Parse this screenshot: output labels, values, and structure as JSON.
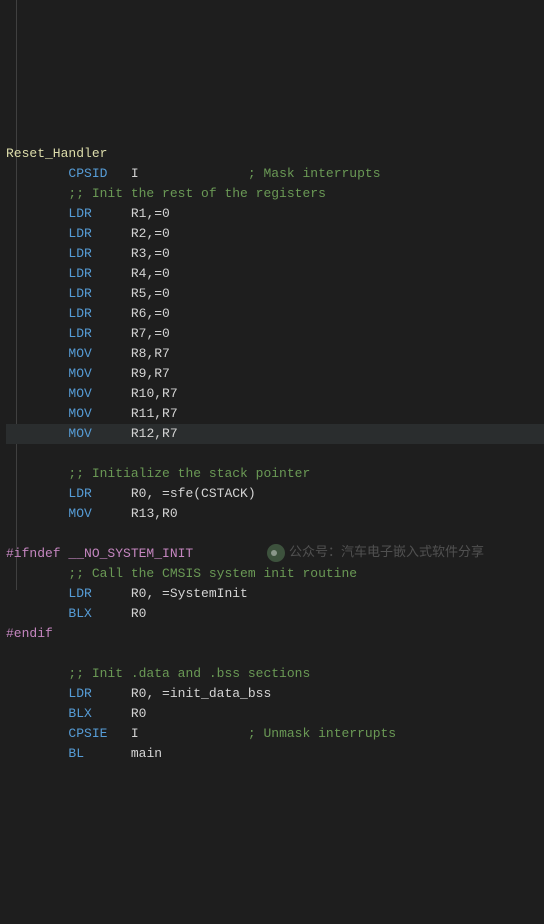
{
  "label": "Reset_Handler",
  "lines": [
    {
      "indent": 8,
      "mnemonic": "CPSID",
      "args": "I",
      "args_pad": 15,
      "comment": "; Mask interrupts"
    },
    {
      "indent": 8,
      "comment_only": ";; Init the rest of the registers"
    },
    {
      "indent": 8,
      "mnemonic": "LDR",
      "args": "R1,=0"
    },
    {
      "indent": 8,
      "mnemonic": "LDR",
      "args": "R2,=0"
    },
    {
      "indent": 8,
      "mnemonic": "LDR",
      "args": "R3,=0"
    },
    {
      "indent": 8,
      "mnemonic": "LDR",
      "args": "R4,=0"
    },
    {
      "indent": 8,
      "mnemonic": "LDR",
      "args": "R5,=0"
    },
    {
      "indent": 8,
      "mnemonic": "LDR",
      "args": "R6,=0"
    },
    {
      "indent": 8,
      "mnemonic": "LDR",
      "args": "R7,=0"
    },
    {
      "indent": 8,
      "mnemonic": "MOV",
      "args": "R8,R7"
    },
    {
      "indent": 8,
      "mnemonic": "MOV",
      "args": "R9,R7"
    },
    {
      "indent": 8,
      "mnemonic": "MOV",
      "args": "R10,R7"
    },
    {
      "indent": 8,
      "mnemonic": "MOV",
      "args": "R11,R7"
    },
    {
      "indent": 8,
      "mnemonic": "MOV",
      "args": "R12,R7",
      "highlight": true
    },
    {
      "blank": true
    },
    {
      "indent": 8,
      "comment_only": ";; Initialize the stack pointer"
    },
    {
      "indent": 8,
      "mnemonic": "LDR",
      "args": "R0, =sfe(CSTACK)"
    },
    {
      "indent": 8,
      "mnemonic": "MOV",
      "args": "R13,R0"
    },
    {
      "blank": true
    }
  ],
  "pre_ifndef": "#ifndef __NO_SYSTEM_INIT",
  "block2": [
    {
      "indent": 8,
      "comment_only": ";; Call the CMSIS system init routine"
    },
    {
      "indent": 8,
      "mnemonic": "LDR",
      "args": "R0, =SystemInit"
    },
    {
      "indent": 8,
      "mnemonic": "BLX",
      "args": "R0"
    }
  ],
  "pre_endif": "#endif",
  "block3": [
    {
      "blank": true
    },
    {
      "indent": 8,
      "comment_only": ";; Init .data and .bss sections"
    },
    {
      "indent": 8,
      "mnemonic": "LDR",
      "args": "R0, =init_data_bss"
    },
    {
      "indent": 8,
      "mnemonic": "BLX",
      "args": "R0"
    },
    {
      "indent": 8,
      "mnemonic": "CPSIE",
      "args": "I",
      "args_pad": 15,
      "comment": "; Unmask interrupts"
    },
    {
      "indent": 8,
      "mnemonic": "BL",
      "args": "main"
    }
  ],
  "watermark": "公众号：汽车电子嵌入式软件分享"
}
